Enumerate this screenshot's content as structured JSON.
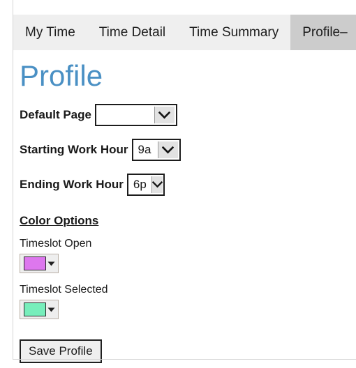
{
  "tabs": [
    {
      "label": "My Time",
      "active": false
    },
    {
      "label": "Time Detail",
      "active": false
    },
    {
      "label": "Time Summary",
      "active": false
    },
    {
      "label": "Profile–",
      "active": true
    }
  ],
  "page": {
    "title": "Profile"
  },
  "form": {
    "default_page": {
      "label": "Default Page",
      "value": "",
      "options": []
    },
    "starting_work_hour": {
      "label": "Starting Work Hour",
      "value": "9a"
    },
    "ending_work_hour": {
      "label": "Ending Work Hour",
      "value": "6p"
    }
  },
  "color_options": {
    "heading": "Color Options",
    "timeslot_open": {
      "label": "Timeslot Open",
      "color": "#DD77EE"
    },
    "timeslot_selected": {
      "label": "Timeslot Selected",
      "color": "#77EEBB"
    }
  },
  "actions": {
    "save_label": "Save Profile"
  },
  "theme": {
    "title_color": "#4A90C4",
    "tab_bar_bg": "#EFEFEF",
    "tab_active_bg": "#CCCCCC",
    "button_bg": "#EFEFEF",
    "rule_color": "#D5D5D5"
  }
}
